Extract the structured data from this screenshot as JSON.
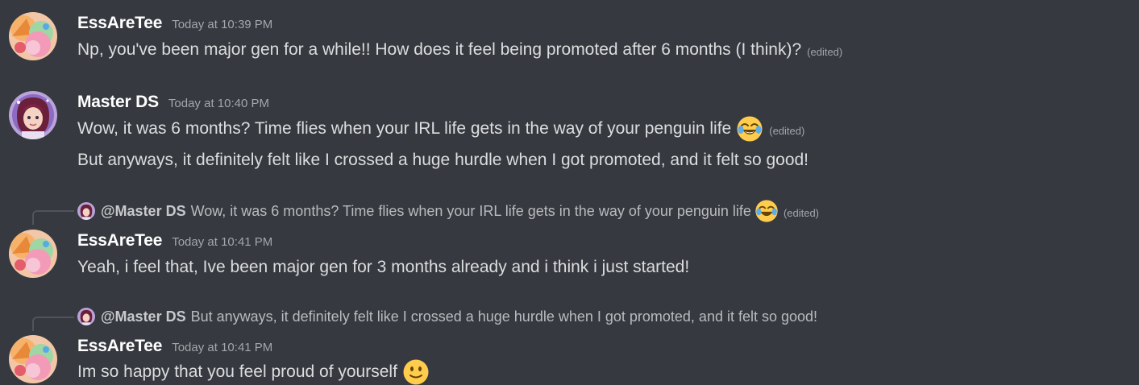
{
  "messages": [
    {
      "author": "EssAreTee",
      "time": "Today at 10:39 PM",
      "lines": [
        {
          "text": "Np, you've been major gen for a while!! How does it feel being promoted after 6 months (I think)?",
          "edited": "(edited)"
        }
      ]
    },
    {
      "author": "Master DS",
      "time": "Today at 10:40 PM",
      "lines": [
        {
          "text": "Wow, it was 6 months? Time flies when your IRL life gets in the way of your penguin life",
          "emoji": "joy-emoji",
          "edited": "(edited)"
        },
        {
          "text": "But anyways, it definitely felt like I crossed a huge hurdle when I got promoted, and it felt so good!"
        }
      ]
    },
    {
      "reply": {
        "mention": "@Master DS",
        "text": "Wow, it was 6 months? Time flies when your IRL life gets in the way of your penguin life",
        "emoji": "joy-emoji",
        "edited": "(edited)"
      },
      "author": "EssAreTee",
      "time": "Today at 10:41 PM",
      "lines": [
        {
          "text": "Yeah, i feel that, Ive been major gen for 3 months already and i think i just started!"
        }
      ]
    },
    {
      "reply": {
        "mention": "@Master DS",
        "text": "But anyways, it definitely felt like I crossed a huge hurdle when I got promoted, and it felt so good!"
      },
      "author": "EssAreTee",
      "time": "Today at 10:41 PM",
      "lines": [
        {
          "text": "Im so happy that you feel proud of yourself",
          "emoji": "slight-smile-emoji"
        }
      ]
    }
  ],
  "colors": {
    "background": "#36393f",
    "username": "#ffffff",
    "message_text": "#dcddde",
    "muted": "#a3a6aa",
    "reply_spine": "#4f545c"
  }
}
